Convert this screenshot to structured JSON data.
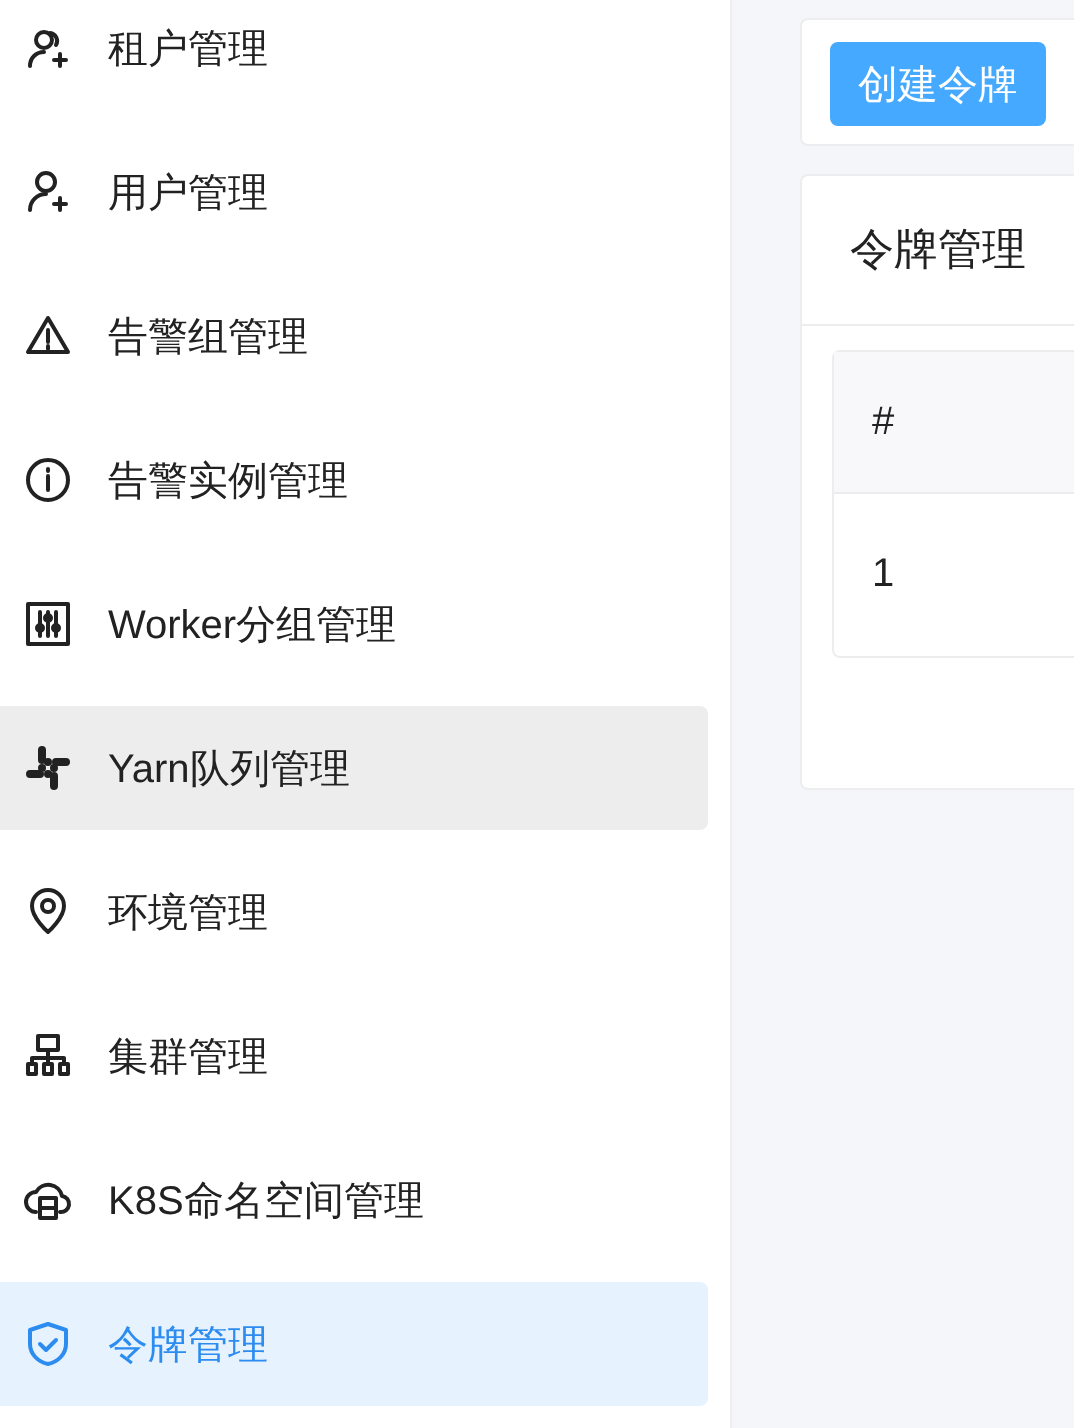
{
  "sidebar": {
    "items": [
      {
        "label": "租户管理",
        "selected": false,
        "hovered": false
      },
      {
        "label": "用户管理",
        "selected": false,
        "hovered": false
      },
      {
        "label": "告警组管理",
        "selected": false,
        "hovered": false
      },
      {
        "label": "告警实例管理",
        "selected": false,
        "hovered": false
      },
      {
        "label": "Worker分组管理",
        "selected": false,
        "hovered": false
      },
      {
        "label": "Yarn队列管理",
        "selected": false,
        "hovered": true
      },
      {
        "label": "环境管理",
        "selected": false,
        "hovered": false
      },
      {
        "label": "集群管理",
        "selected": false,
        "hovered": false
      },
      {
        "label": "K8S命名空间管理",
        "selected": false,
        "hovered": false
      },
      {
        "label": "令牌管理",
        "selected": true,
        "hovered": false
      }
    ]
  },
  "toolbar": {
    "create_button": "创建令牌"
  },
  "panel": {
    "title": "令牌管理",
    "table": {
      "columns": [
        "#"
      ],
      "rows": [
        [
          "1"
        ]
      ]
    }
  }
}
